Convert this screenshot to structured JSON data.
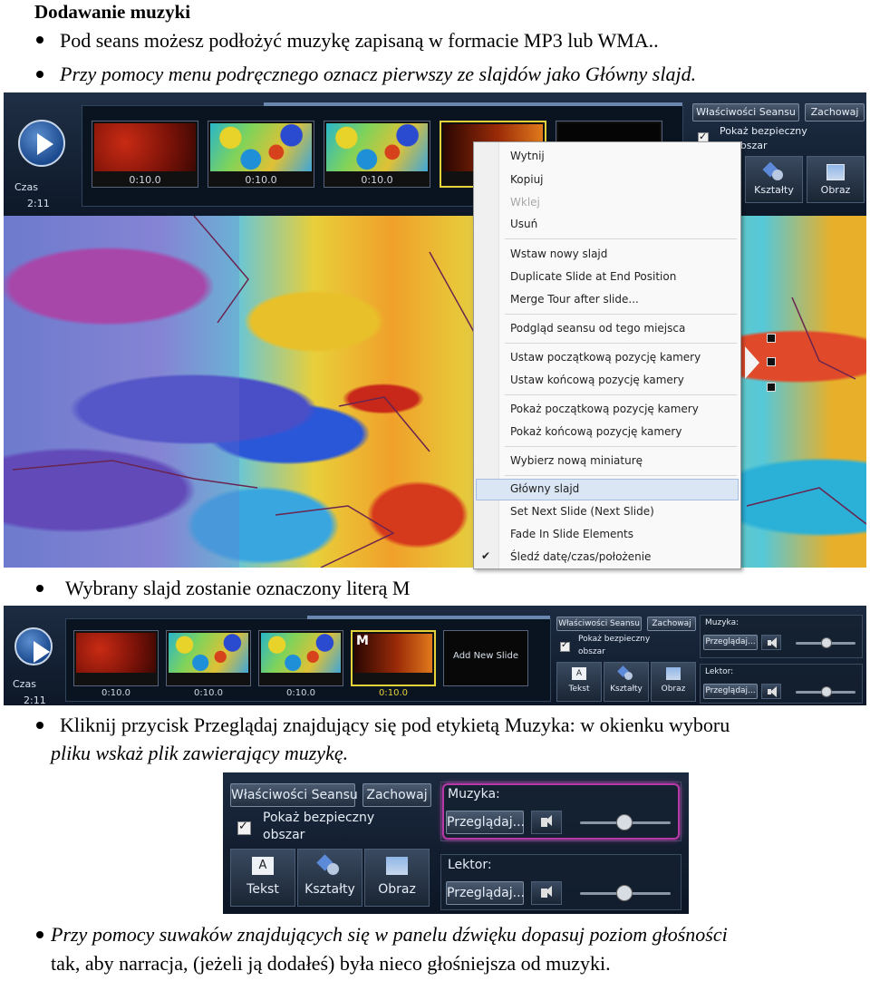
{
  "doc": {
    "heading": "Dodawanie muzyki",
    "line1": "Pod seans możesz podłożyć muzykę zapisaną w formacie MP3 lub WMA..",
    "line2": "Przy pomocy menu podręcznego oznacz pierwszy ze slajdów jako Główny slajd.",
    "line3": "Wybrany slajd zostanie oznaczony literą M",
    "line4a": "Kliknij przycisk Przeglądaj znajdujący się pod etykietą Muzyka: w okienku wyboru",
    "line4b": "pliku wskaż plik zawierający muzykę.",
    "line5a": "Przy pomocy suwaków znajdujących się w panelu dźwięku dopasuj poziom głośności",
    "line5b": "tak, aby narracja, (jeżeli ją dodałeś) była nieco głośniejsza od muzyki."
  },
  "ui": {
    "czas_label": "Czas",
    "czas_value": "2:11",
    "thumb_time": "0:10.0",
    "tour_properties": "Właściwości Seansu",
    "save": "Zachowaj",
    "show_safe_area_1": "Pokaż bezpieczny",
    "show_safe_area_2": "obszar",
    "text_tool": "Tekst",
    "shapes_tool": "Kształty",
    "image_tool": "Obraz",
    "add_new_slide": "Add New Slide",
    "master_marker": "M",
    "music_label": "Muzyka:",
    "narrator_label": "Lektor:",
    "browse": "Przeglądaj..."
  },
  "context_menu": {
    "items": [
      "Wytnij",
      "Kopiuj",
      "Wklej",
      "Usuń",
      "Wstaw nowy slajd",
      "Duplicate Slide at End Position",
      "Merge Tour after slide...",
      "Podgląd seansu od tego miejsca",
      "Ustaw początkową pozycję kamery",
      "Ustaw końcową pozycję kamery",
      "Pokaż początkową pozycję kamery",
      "Pokaż końcową pozycję kamery",
      "Wybierz nową miniaturę",
      "Główny slajd",
      "Set Next Slide (Next Slide)",
      "Fade In Slide Elements",
      "Śledź datę/czas/położenie"
    ],
    "disabled_item": "Wklej",
    "highlighted_item": "Główny slajd",
    "checked_item": "Śledź datę/czas/położenie"
  },
  "colors": {
    "selection_yellow": "#e6d23a",
    "focus_magenta": "#b83aa8",
    "menu_highlight": "#dbe6f5"
  },
  "icons": [
    "play-icon",
    "checkbox-icon",
    "text-icon",
    "shapes-icon",
    "image-icon",
    "speaker-icon",
    "next-slide-arrow-icon"
  ]
}
